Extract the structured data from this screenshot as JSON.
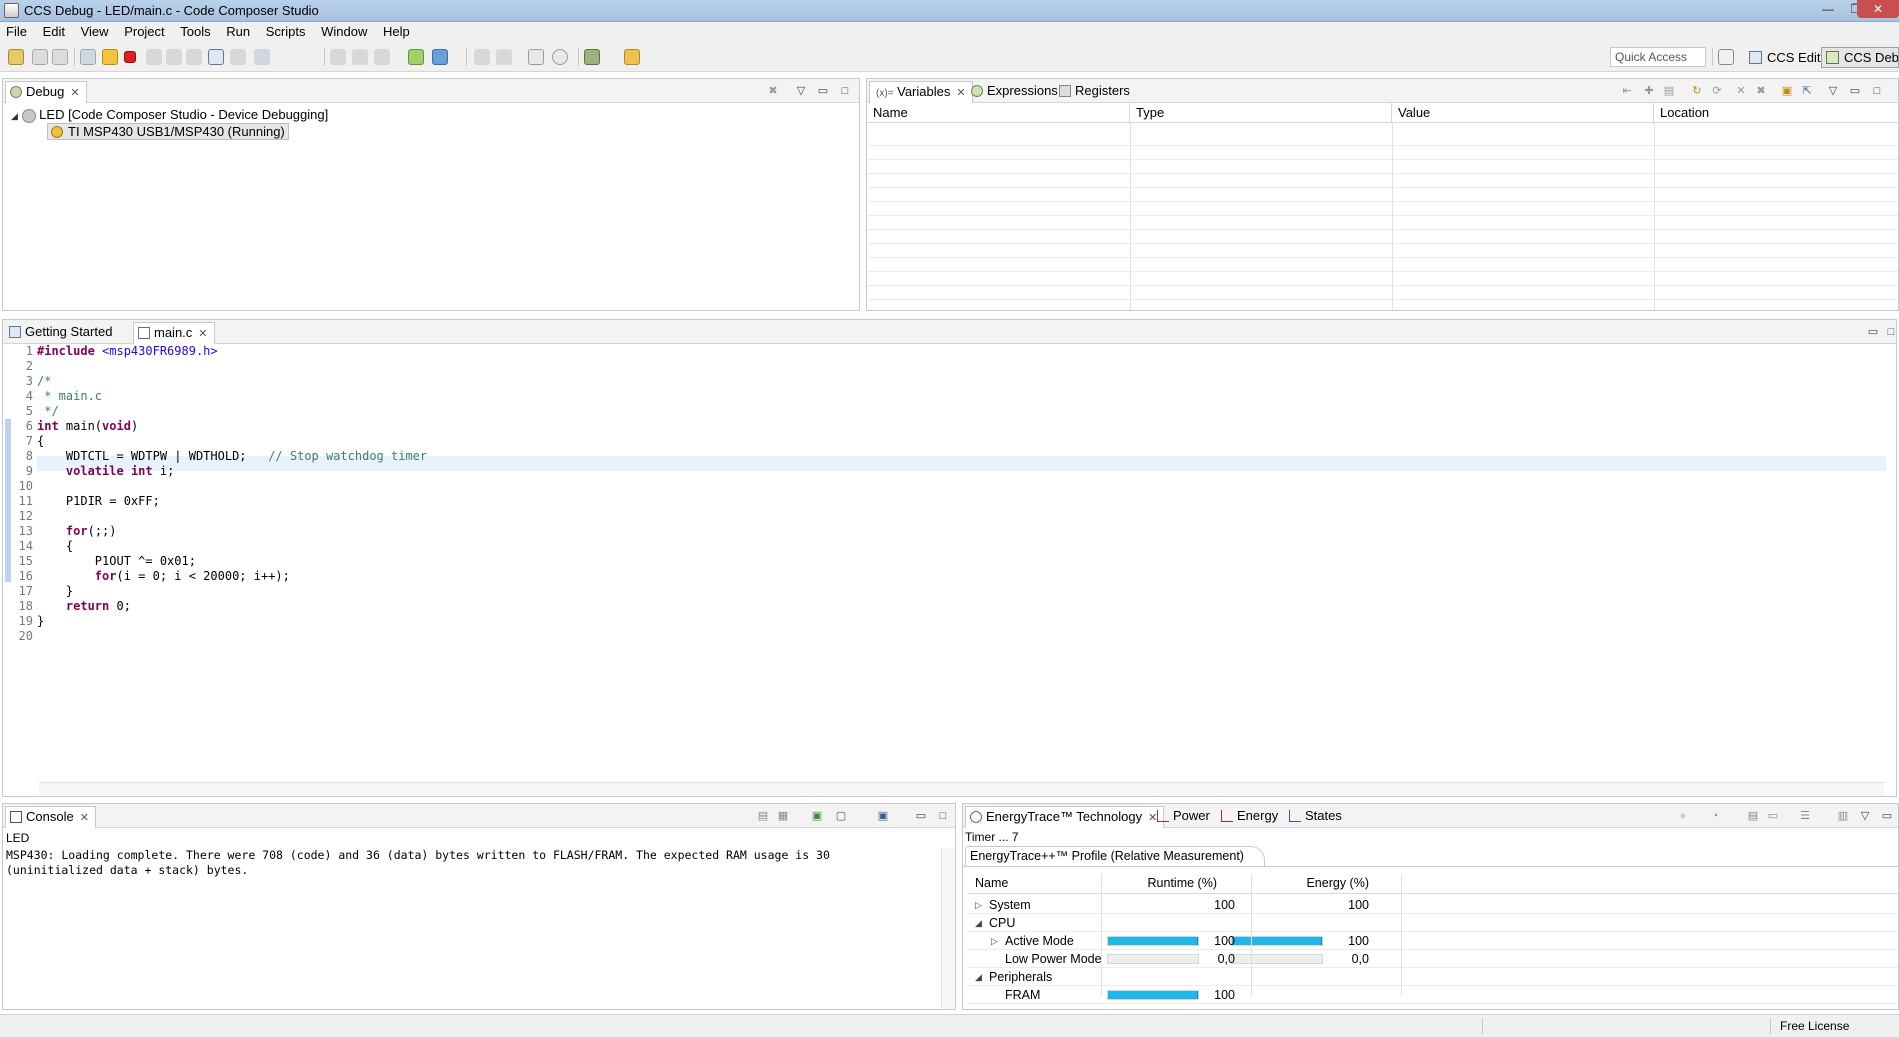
{
  "window": {
    "title": "CCS Debug - LED/main.c - Code Composer Studio",
    "controls": {
      "minimize": "—",
      "restore": "❐",
      "close": "✕"
    }
  },
  "menu": [
    "File",
    "Edit",
    "View",
    "Project",
    "Tools",
    "Run",
    "Scripts",
    "Window",
    "Help"
  ],
  "toolbar": {
    "quick_access": "Quick Access",
    "perspectives": [
      "CCS Edit",
      "CCS Debug"
    ]
  },
  "debug_view": {
    "tab": "Debug",
    "items": [
      "LED [Code Composer Studio - Device Debugging]",
      "TI MSP430 USB1/MSP430 (Running)"
    ]
  },
  "variables_view": {
    "tabs": [
      "Variables",
      "Expressions",
      "Registers"
    ],
    "tab_prefix": "(x)=",
    "columns": [
      "Name",
      "Type",
      "Value",
      "Location"
    ]
  },
  "editor": {
    "tabs": [
      "Getting Started",
      "main.c"
    ],
    "lines": [
      {
        "n": "1",
        "html": "<span class=\"pp\">#include</span> <span class=\"inc\">&lt;msp430FR6989.h&gt;</span>"
      },
      {
        "n": "2",
        "html": ""
      },
      {
        "n": "3",
        "html": "<span class=\"cm\">/*</span>"
      },
      {
        "n": "4",
        "html": "<span class=\"cm\"> * main.c</span>"
      },
      {
        "n": "5",
        "html": "<span class=\"cm\"> */</span>"
      },
      {
        "n": "6",
        "html": "<span class=\"kw\">int</span> main(<span class=\"kw\">void</span>)"
      },
      {
        "n": "7",
        "html": "{"
      },
      {
        "n": "8",
        "html": "    WDTCTL = WDTPW | WDTHOLD;   <span class=\"cm\">// Stop watchdog timer</span>"
      },
      {
        "n": "9",
        "html": "    <span class=\"kw\">volatile</span> <span class=\"kw\">int</span> i;"
      },
      {
        "n": "10",
        "html": ""
      },
      {
        "n": "11",
        "html": "    P1DIR = 0xFF;"
      },
      {
        "n": "12",
        "html": ""
      },
      {
        "n": "13",
        "html": "    <span class=\"kw\">for</span>(;;)"
      },
      {
        "n": "14",
        "html": "    {"
      },
      {
        "n": "15",
        "html": "        P1OUT ^= 0x01;"
      },
      {
        "n": "16",
        "html": "        <span class=\"kw\">for</span>(i = 0; i &lt; 20000; i++);"
      },
      {
        "n": "17",
        "html": "    }"
      },
      {
        "n": "18",
        "html": "    <span class=\"kw\">return</span> 0;"
      },
      {
        "n": "19",
        "html": "}"
      },
      {
        "n": "20",
        "html": ""
      }
    ]
  },
  "console": {
    "tab": "Console",
    "label": "LED",
    "output": "MSP430: Loading complete. There were 708 (code) and 36 (data) bytes written to FLASH/FRAM. The expected RAM usage is 30\n(uninitialized data + stack) bytes."
  },
  "energy": {
    "tabs": [
      "EnergyTrace™ Technology",
      "Power",
      "Energy",
      "States"
    ],
    "timer": "Timer ... 7",
    "profile_tab": "EnergyTrace++™ Profile (Relative Measurement)",
    "columns": [
      "Name",
      "Runtime (%)",
      "Energy (%)"
    ],
    "rows": [
      {
        "name": "System",
        "indent": 1,
        "expander": "▷",
        "runtime": "100",
        "energy": "100",
        "bars": false
      },
      {
        "name": "CPU",
        "indent": 1,
        "expander": "◢",
        "runtime": "",
        "energy": "",
        "bars": false
      },
      {
        "name": "Active Mode",
        "indent": 2,
        "expander": "▷",
        "runtime": "100",
        "energy": "100",
        "bars": true,
        "runtime_frac": 1.0,
        "energy_frac": 1.0
      },
      {
        "name": "Low Power Mode",
        "indent": 2,
        "expander": "",
        "runtime": "0,0",
        "energy": "0,0",
        "bars": true,
        "runtime_frac": 0.0,
        "energy_frac": 0.0
      },
      {
        "name": "Peripherals",
        "indent": 1,
        "expander": "◢",
        "runtime": "",
        "energy": "",
        "bars": false
      },
      {
        "name": "FRAM",
        "indent": 2,
        "expander": "",
        "runtime": "100",
        "energy": "",
        "bars": true,
        "runtime_frac": 1.0,
        "energy_frac": null
      }
    ]
  },
  "status": {
    "license": "Free License"
  },
  "colors": {
    "bar_fill": "#1fb6e8",
    "title_bar": "#b9d1ea"
  }
}
